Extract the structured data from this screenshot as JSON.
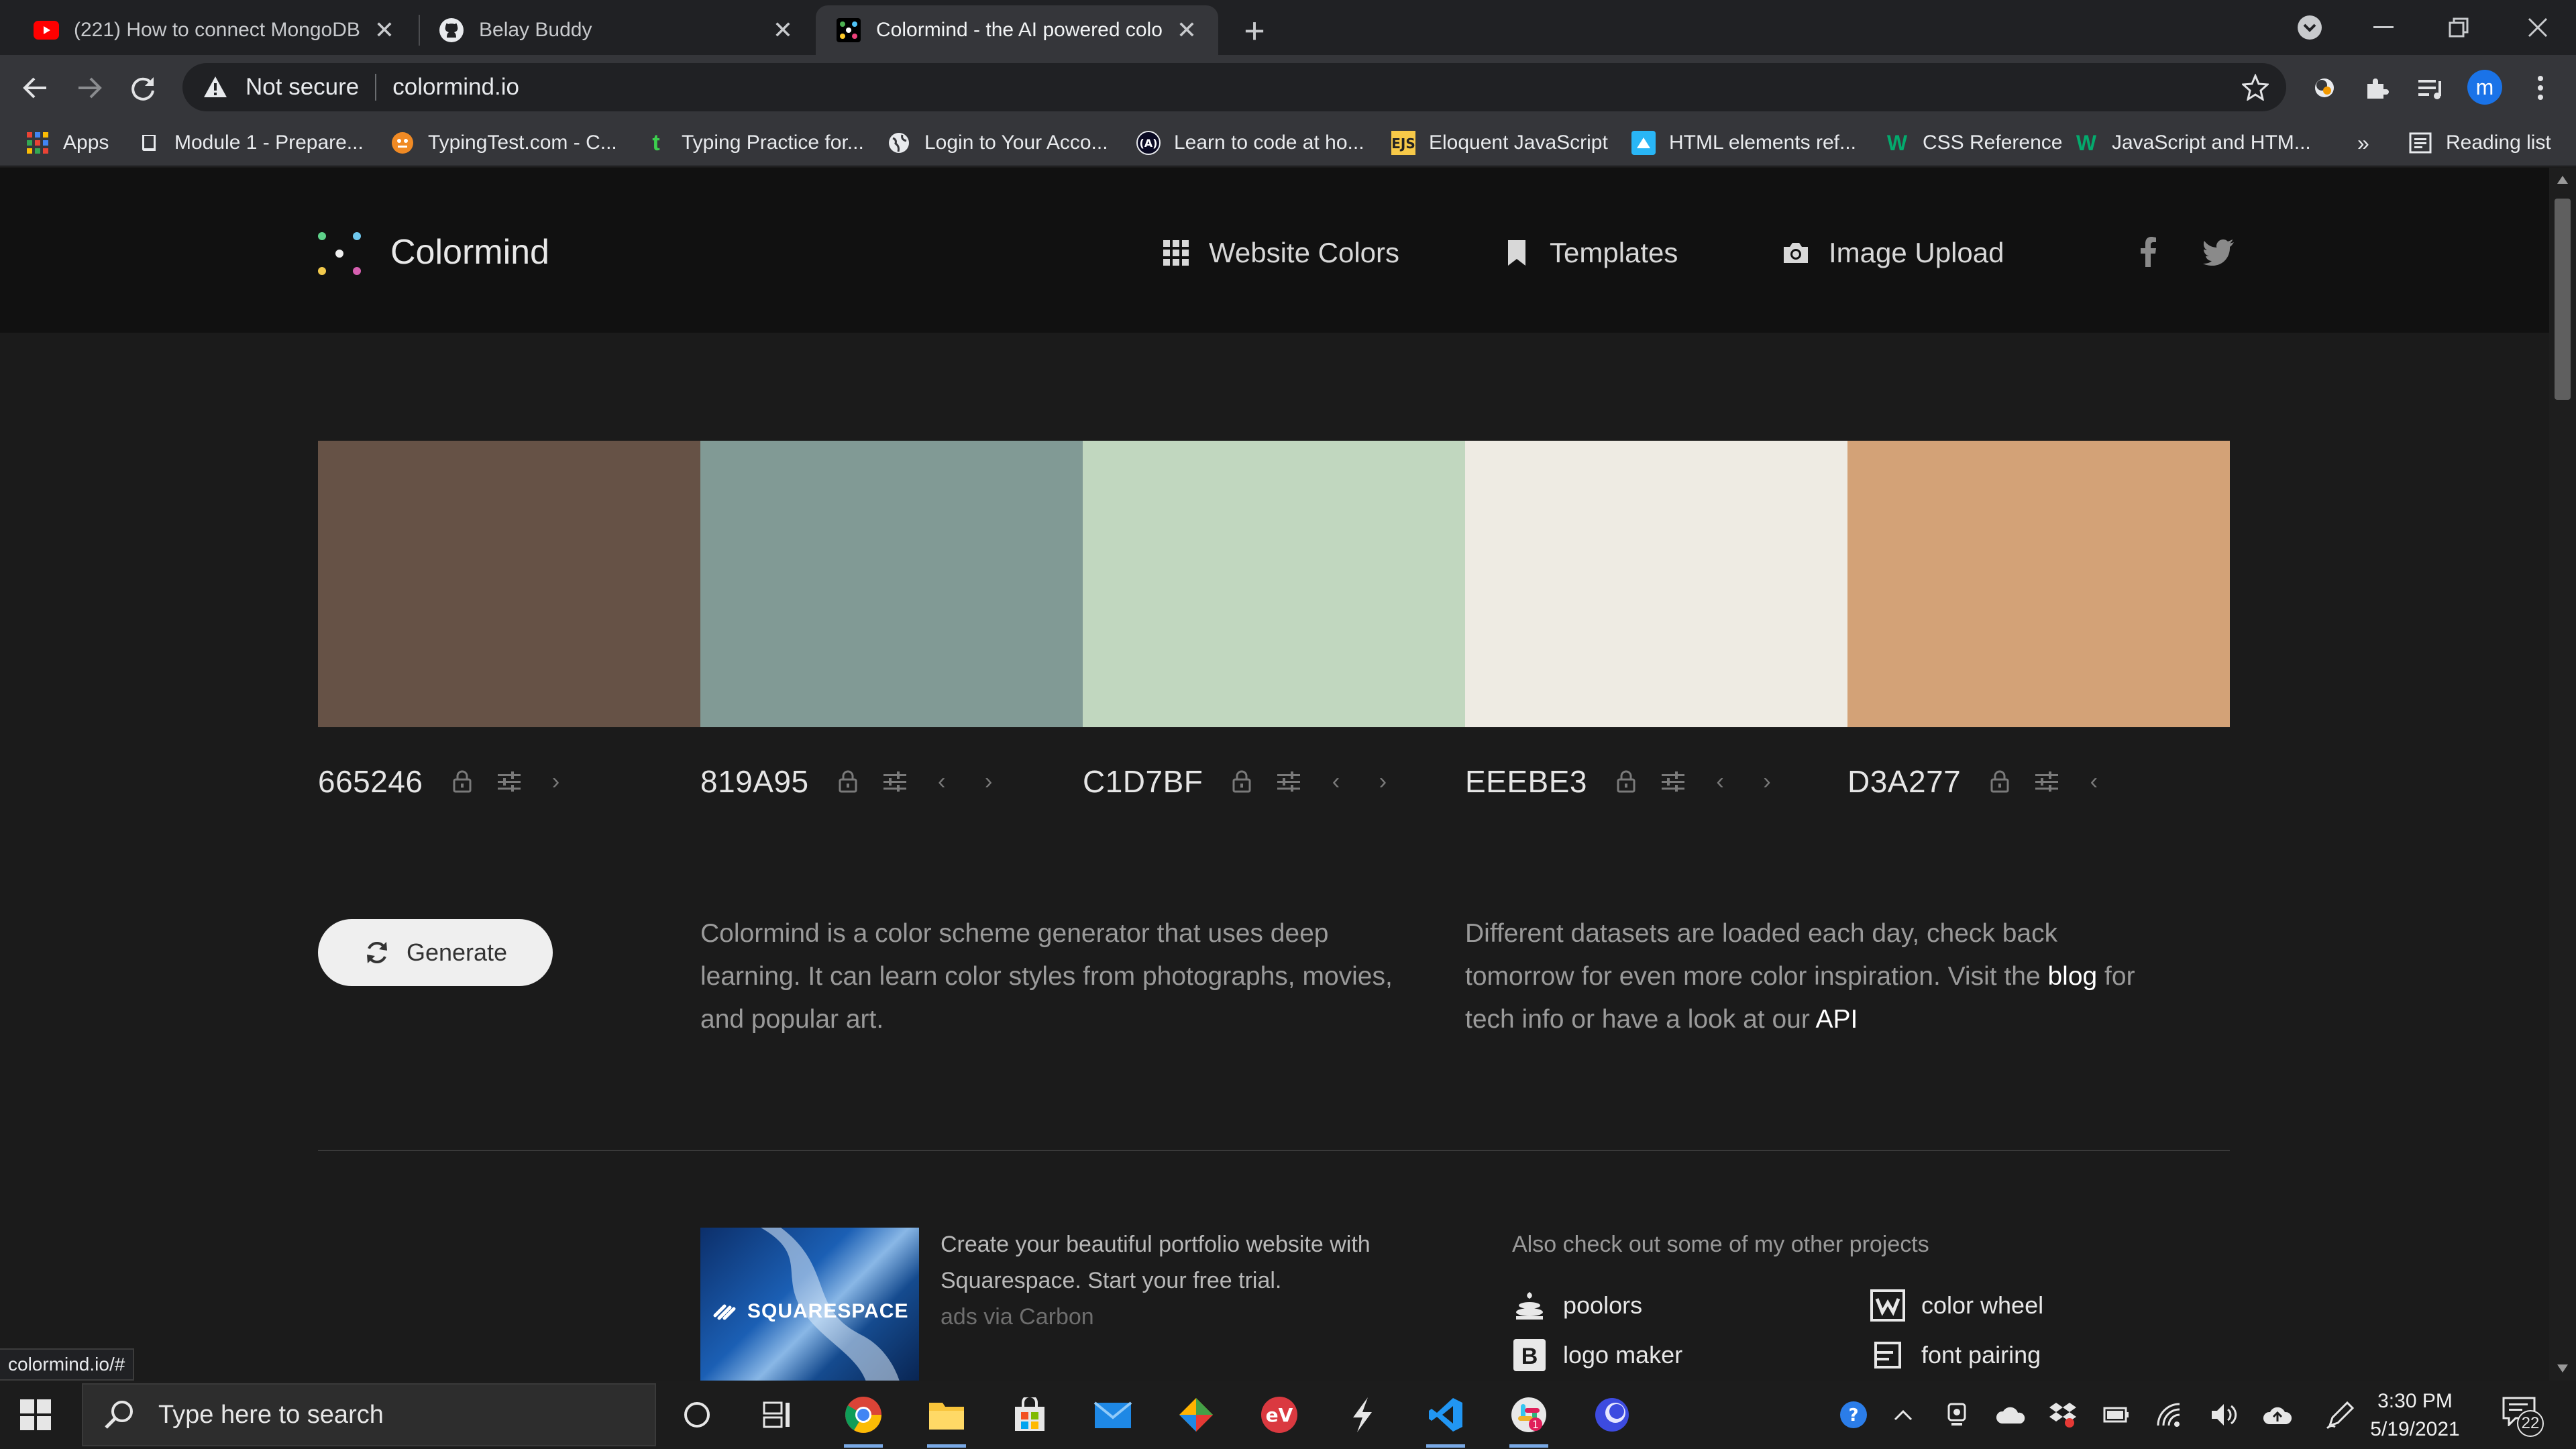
{
  "browser": {
    "tabs": [
      {
        "title": "(221) How to connect MongoDB",
        "icon": "youtube-icon"
      },
      {
        "title": "Belay Buddy",
        "icon": "github-icon"
      },
      {
        "title": "Colormind - the AI powered color",
        "icon": "colormind-icon",
        "active": true
      }
    ],
    "security_label": "Not secure",
    "url": "colormind.io",
    "profile_initial": "m",
    "bookmarks": [
      {
        "label": "Apps",
        "icon": "apps-grid-icon"
      },
      {
        "label": "Module 1 - Prepare...",
        "icon": "book-icon"
      },
      {
        "label": "TypingTest.com - C...",
        "icon": "typingtest-icon"
      },
      {
        "label": "Typing Practice for...",
        "icon": "typing-t-icon"
      },
      {
        "label": "Login to Your Acco...",
        "icon": "globe-icon"
      },
      {
        "label": "Learn to code at ho...",
        "icon": "fcc-icon"
      },
      {
        "label": "Eloquent JavaScript",
        "icon": "ejs-icon"
      },
      {
        "label": "HTML elements ref...",
        "icon": "mdn-icon"
      },
      {
        "label": "CSS Reference",
        "icon": "w3-icon"
      },
      {
        "label": "JavaScript and HTM...",
        "icon": "w3-icon"
      }
    ],
    "overflow_label": "»",
    "reading_list": "Reading list",
    "status_url": "colormind.io/#"
  },
  "site": {
    "brand": "Colormind",
    "nav": [
      {
        "label": "Website Colors",
        "icon": "grid-icon"
      },
      {
        "label": "Templates",
        "icon": "bookmark-icon"
      },
      {
        "label": "Image Upload",
        "icon": "camera-icon"
      }
    ],
    "palette": [
      {
        "hex": "665246",
        "color": "#665246"
      },
      {
        "hex": "819A95",
        "color": "#819A95"
      },
      {
        "hex": "C1D7BF",
        "color": "#C1D7BF"
      },
      {
        "hex": "EEEBE3",
        "color": "#EEEBE3"
      },
      {
        "hex": "D3A277",
        "color": "#D3A277"
      }
    ],
    "generate_label": "Generate",
    "about": "Colormind is a color scheme generator that uses deep learning. It can learn color styles from photographs, movies, and popular art.",
    "datasets_pre": "Different datasets are loaded each day, check back tomorrow for even more color inspiration. Visit the ",
    "blog_link": "blog",
    "datasets_mid": " for tech info or have a look at our ",
    "api_link": "API",
    "ad_brand": "SQUARESPACE",
    "ad_text": "Create your beautiful portfolio website with Squarespace. Start your free trial.",
    "ad_via": "ads via Carbon",
    "projects_heading": "Also check out some of my other projects",
    "projects": [
      {
        "label": "poolors",
        "icon": "poolors-icon"
      },
      {
        "label": "color wheel",
        "icon": "color-wheel-icon"
      },
      {
        "label": "logo maker",
        "icon": "logo-maker-icon"
      },
      {
        "label": "font pairing",
        "icon": "font-pairing-icon"
      }
    ]
  },
  "taskbar": {
    "search_placeholder": "Type here to search",
    "time": "3:30 PM",
    "date": "5/19/2021",
    "notification_count": "22"
  }
}
